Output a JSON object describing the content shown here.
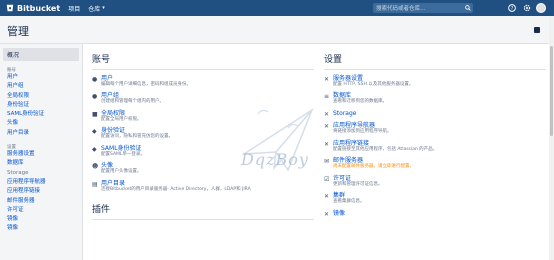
{
  "topbar": {
    "brand": "Bitbucket",
    "nav": [
      {
        "label": "项目",
        "has_caret": false
      },
      {
        "label": "仓库",
        "has_caret": true
      }
    ],
    "search_placeholder": "搜索代码或者仓库...",
    "colors": {
      "nav_bg": "#205081",
      "link": "#0052cc"
    }
  },
  "page": {
    "title": "管理"
  },
  "sidebar": {
    "overview": "概况",
    "groups": [
      {
        "title": "账号",
        "items": [
          "用户",
          "用户组",
          "全局权限",
          "身份验证",
          "SAML身份验证",
          "头像",
          "用户目录"
        ]
      },
      {
        "title": "设置",
        "items": [
          "服务器设置",
          "数据库",
          "Storage",
          "应用程序导航器",
          "应用程序链接",
          "邮件服务器",
          "许可证",
          "镜像",
          "镜像"
        ]
      }
    ]
  },
  "account": {
    "title": "账号",
    "entries": [
      {
        "icon": "user-icon",
        "title": "用户",
        "desc": "编辑每个用户详细信息，密码和组成员身份。"
      },
      {
        "icon": "users-icon",
        "title": "用户组",
        "desc": "创建组和管理每个组内的用户。"
      },
      {
        "icon": "lock-icon",
        "title": "全局权限",
        "desc": "配置全局用户权限。"
      },
      {
        "icon": "shield-icon",
        "title": "身份验证",
        "desc": "配置访问，隐私和冒充仿您的设置。"
      },
      {
        "icon": "shield-icon",
        "title": "SAML身份验证",
        "desc": "配置SAML单一登录。"
      },
      {
        "icon": "avatar-icon",
        "title": "头像",
        "desc": "配置用户头像设置。"
      },
      {
        "icon": "directory-icon",
        "title": "用户目录",
        "desc": "连接Bitbucket的用户目录服务器- Active Directory，人群，LDAP和 JIRA"
      }
    ],
    "plugins_title": "插件"
  },
  "settings": {
    "title": "设置",
    "entries": [
      {
        "icon": "wrench-icon",
        "title": "服务器设置",
        "desc": "配置 HTTP, SSH 以及其他服务器设置。",
        "warn": false
      },
      {
        "icon": "database-icon",
        "title": "数据库",
        "desc": "查看和迁移到您的数据库。",
        "warn": false
      },
      {
        "icon": "wrench-icon",
        "title": "Storage",
        "desc": "",
        "warn": false
      },
      {
        "icon": "wrench-icon",
        "title": "应用程序导航器",
        "desc": "将链接添加到应用程序导航。",
        "warn": false
      },
      {
        "icon": "wrench-icon",
        "title": "应用程序链接",
        "desc": "配置链接至其他应用程序，包括 Atlassian 的产品。",
        "warn": false
      },
      {
        "icon": "mail-icon",
        "title": "邮件服务器",
        "desc": "尚未配置邮件服务器。请立即进行配置。",
        "warn": true
      },
      {
        "icon": "license-icon",
        "title": "许可证",
        "desc": "更新和管理许可证信息。",
        "warn": false
      },
      {
        "icon": "wrench-icon",
        "title": "集群",
        "desc": "查看集群信息。",
        "warn": false
      },
      {
        "icon": "wrench-icon",
        "title": "镜像",
        "desc": "",
        "warn": false
      }
    ]
  },
  "watermark": {
    "text": "DqzBoy"
  }
}
